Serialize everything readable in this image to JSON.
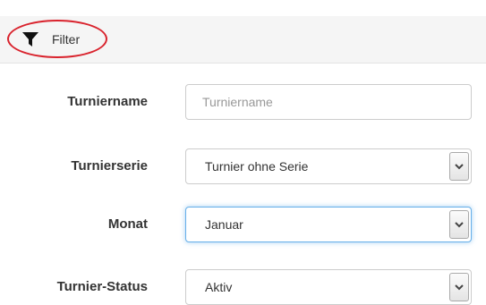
{
  "filter": {
    "label": "Filter",
    "icon": "funnel-icon",
    "highlight_color": "#d9232d"
  },
  "fields": {
    "turniername": {
      "label": "Turniername",
      "placeholder": "Turniername",
      "value": ""
    },
    "turnierserie": {
      "label": "Turnierserie",
      "value": "Turnier ohne Serie"
    },
    "monat": {
      "label": "Monat",
      "value": "Januar"
    },
    "status": {
      "label": "Turnier-Status",
      "value": "Aktiv"
    }
  },
  "colors": {
    "focus": "#66afe9",
    "border": "#cccccc",
    "bar": "#f5f5f5"
  }
}
